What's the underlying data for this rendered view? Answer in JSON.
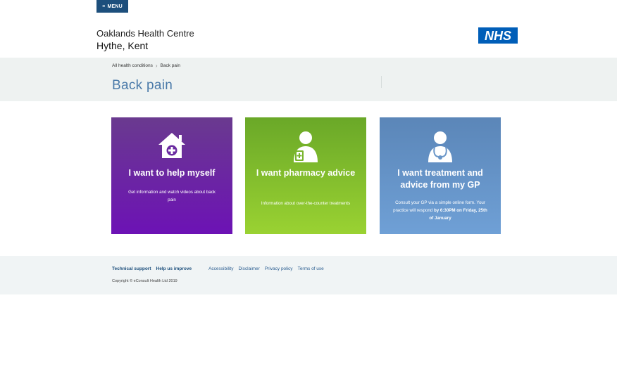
{
  "header": {
    "menu_label": "MENU",
    "practice_name": "Oaklands Health Centre",
    "practice_location": "Hythe, Kent",
    "logo_text": "NHS",
    "logo_color": "#005eb8"
  },
  "breadcrumb": {
    "items": [
      "All health conditions",
      "Back pain"
    ]
  },
  "page": {
    "title": "Back pain"
  },
  "cards": [
    {
      "icon": "house-plus-icon",
      "title": "I want to help myself",
      "description": "Get information and watch videos about back pain",
      "color_top": "#6a3a8f",
      "color_bottom": "#6c12b5"
    },
    {
      "icon": "pharmacist-icon",
      "title": "I want pharmacy advice",
      "description": "Information about over-the-counter treatments",
      "color_top": "#6aa828",
      "color_bottom": "#9ad232"
    },
    {
      "icon": "doctor-icon",
      "title": "I want treatment and advice from my GP",
      "description_lead": "Consult your GP via a simple online form. Your practice will respond",
      "description_strong": "by 6:30PM on Friday, 25th of January",
      "color_top": "#5b86b8",
      "color_bottom": "#6fa0d6"
    }
  ],
  "footer": {
    "primary_links": [
      "Technical support",
      "Help us improve"
    ],
    "secondary_links": [
      "Accessibility",
      "Disclaimer",
      "Privacy policy",
      "Terms of use"
    ],
    "copyright": "Copyright © eConsult Health Ltd 2019"
  }
}
